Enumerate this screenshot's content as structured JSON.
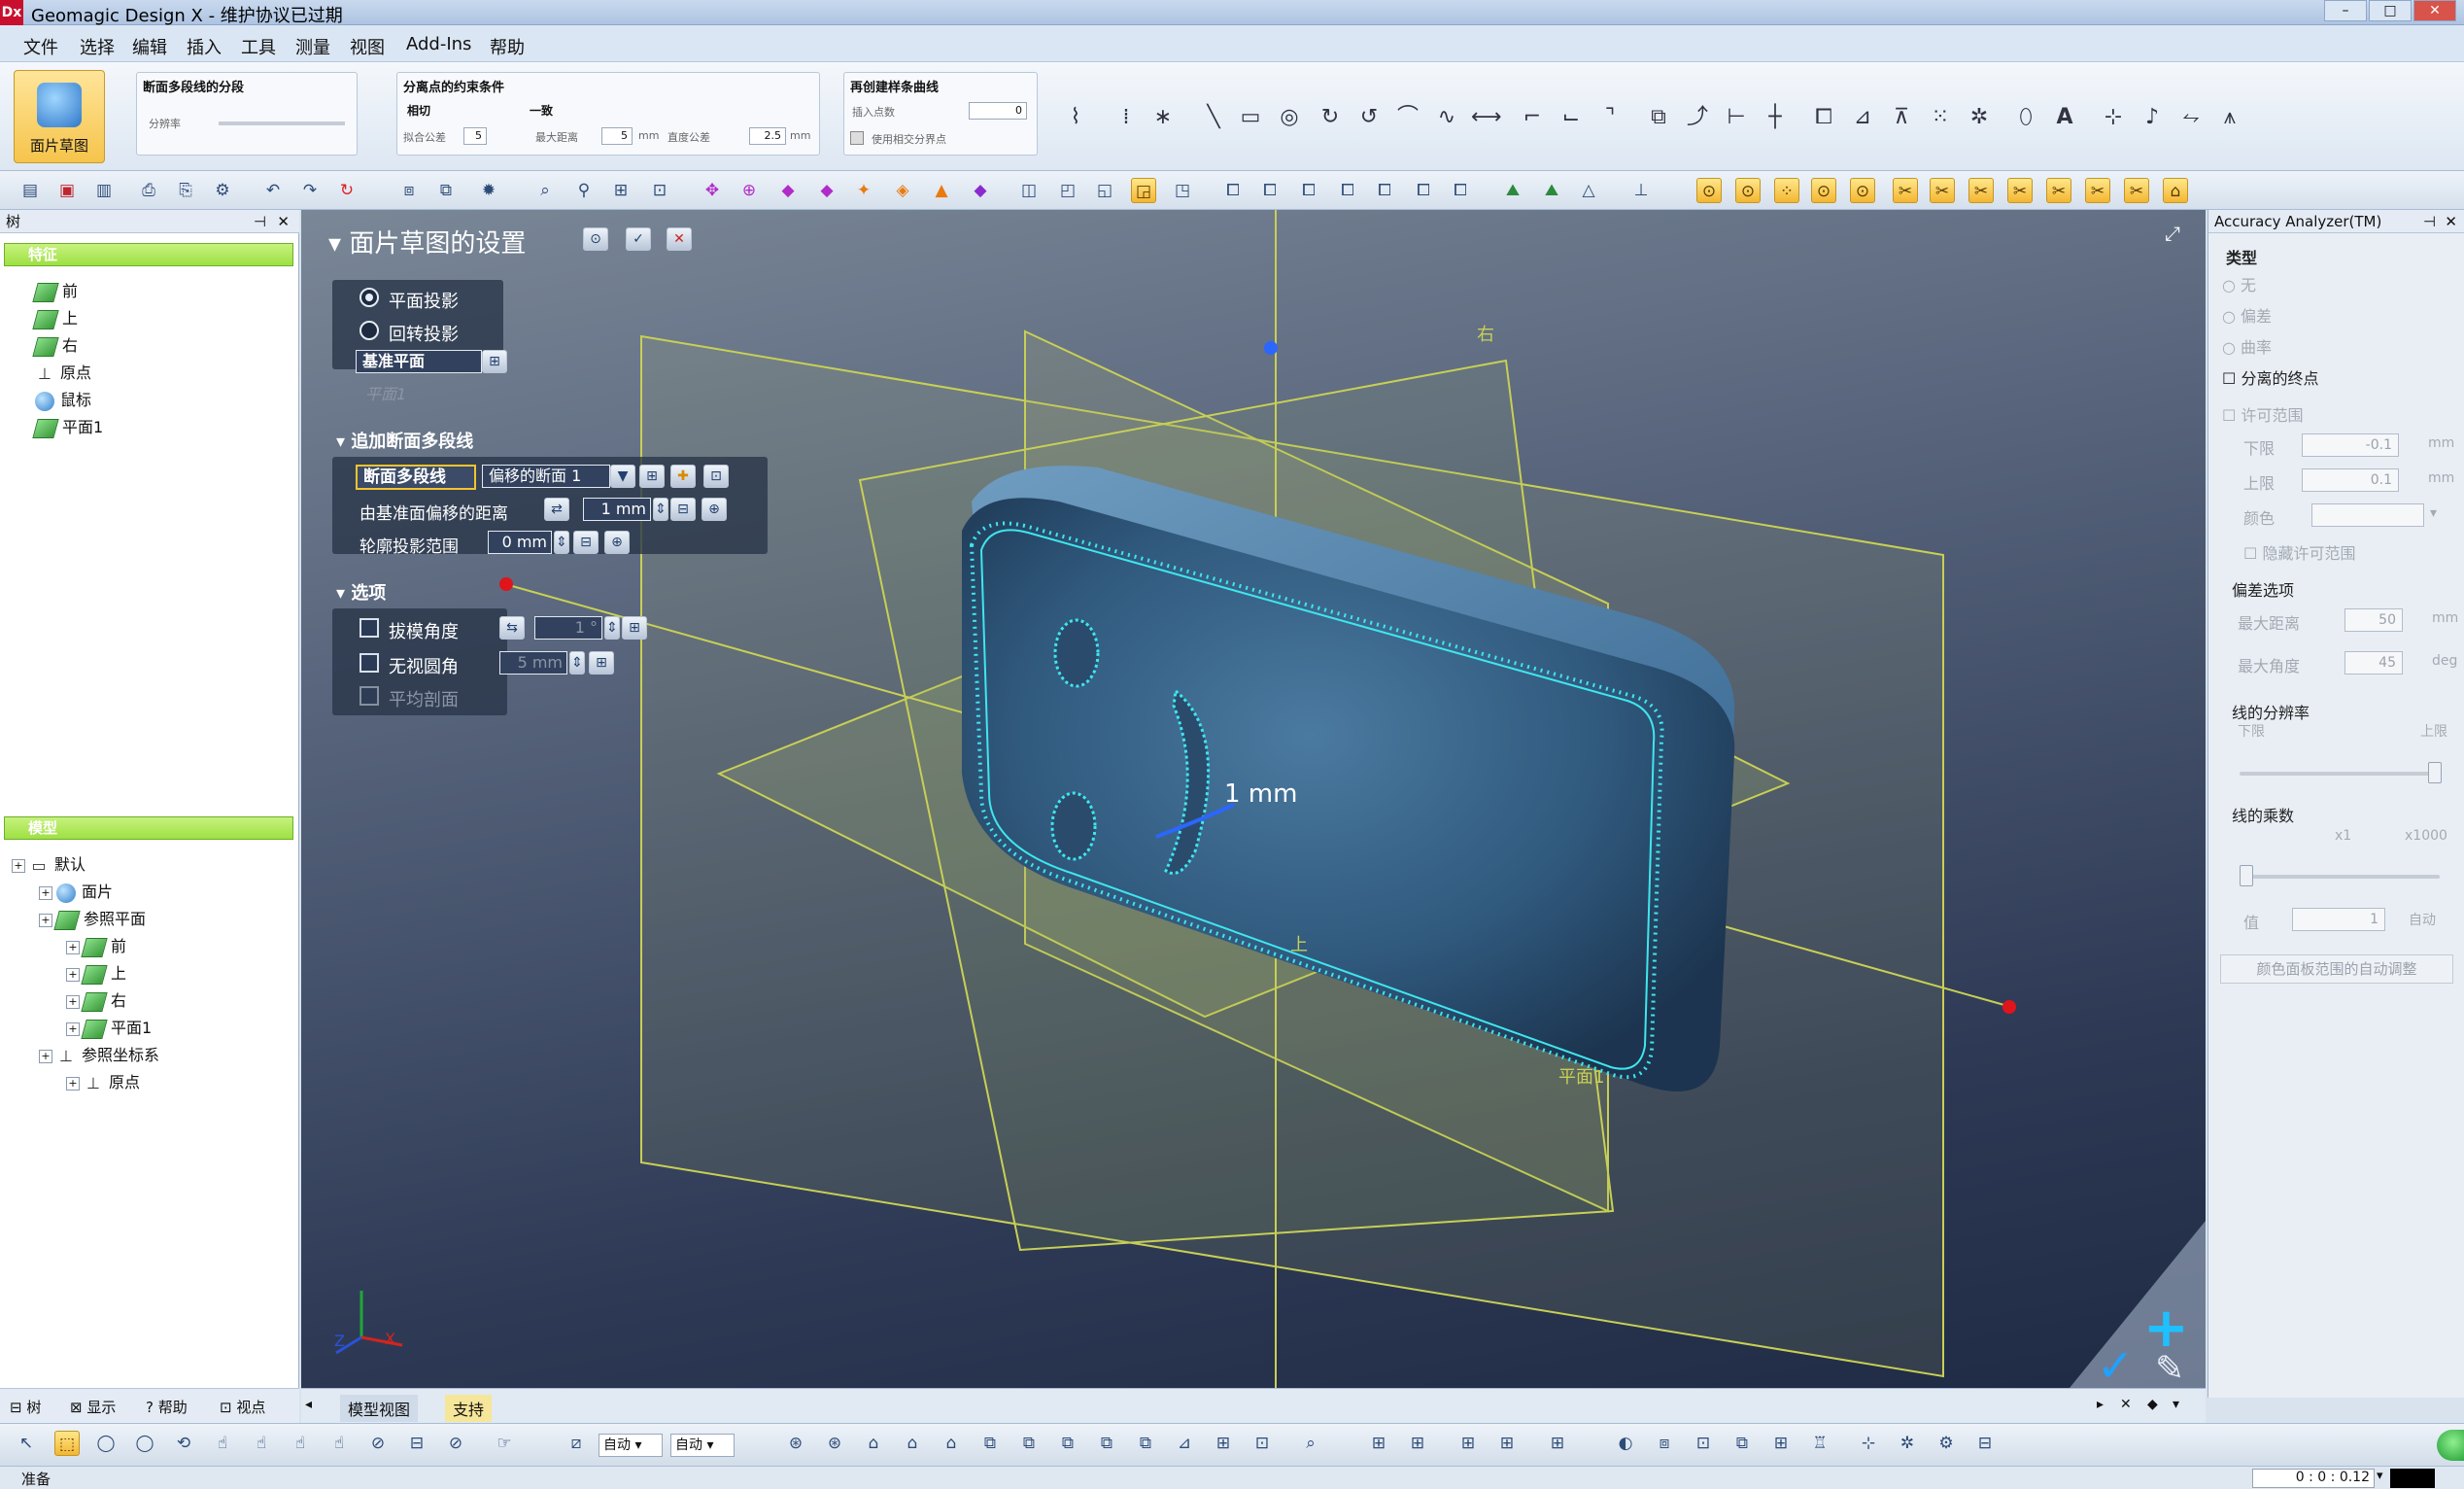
{
  "app": {
    "icon": "Dx",
    "title": "Geomagic Design X - 维护协议已过期"
  },
  "menu": [
    "文件",
    "选择",
    "编辑",
    "插入",
    "工具",
    "测量",
    "视图",
    "Add-Ins",
    "帮助"
  ],
  "ribbon": {
    "big_button": "面片草图",
    "group1": {
      "title": "断面多段线的分段",
      "label": "分辨率"
    },
    "group2": {
      "title": "分离点的约束条件",
      "sub1": "相切",
      "sub2": "一致",
      "f1_label": "拟合公差",
      "f1_value": "5",
      "f2_label": "最大距离",
      "f2_value": "5",
      "f2_unit": "mm",
      "f3_label": "直度公差",
      "f3_value": "2.5",
      "f3_unit": "mm"
    },
    "group3": {
      "title": "再创建样条曲线",
      "label": "插入点数",
      "value": "0",
      "check": "使用相交分界点"
    }
  },
  "left": {
    "header": "树",
    "feature_section": "特征",
    "features": [
      {
        "label": "前",
        "icon": "plane-icon"
      },
      {
        "label": "上",
        "icon": "plane-icon"
      },
      {
        "label": "右",
        "icon": "plane-icon"
      },
      {
        "label": "原点",
        "icon": "axis-icon"
      },
      {
        "label": "鼠标",
        "icon": "mesh-icon"
      },
      {
        "label": "平面1",
        "icon": "plane-icon"
      }
    ],
    "model_section": "模型",
    "model_items": [
      {
        "label": "默认",
        "icon": "folder-icon",
        "indent": 0
      },
      {
        "label": "面片",
        "icon": "mesh-icon",
        "indent": 1
      },
      {
        "label": "参照平面",
        "icon": "plane-icon",
        "indent": 1
      },
      {
        "label": "前",
        "icon": "plane-icon",
        "indent": 2
      },
      {
        "label": "上",
        "icon": "plane-icon",
        "indent": 2
      },
      {
        "label": "右",
        "icon": "plane-icon",
        "indent": 2
      },
      {
        "label": "平面1",
        "icon": "plane-icon",
        "indent": 2
      },
      {
        "label": "参照坐标系",
        "icon": "axis-icon",
        "indent": 1
      },
      {
        "label": "原点",
        "icon": "axis-icon",
        "indent": 2
      }
    ],
    "tabs": [
      "树",
      "显示",
      "帮助",
      "视点"
    ]
  },
  "settings": {
    "title": "面片草图的设置",
    "radio1": "平面投影",
    "radio2": "回转投影",
    "base_plane": "基准平面",
    "base_value": "平面1",
    "section2": "追加断面多段线",
    "section_polyline": "断面多段线",
    "offset_select": "偏移的断面 1",
    "offset_label": "由基准面偏移的距离",
    "offset_value": "1 mm",
    "contour_label": "轮廓投影范围",
    "contour_value": "0 mm",
    "section3": "选项",
    "opt1": "拔模角度",
    "opt1_value": "1 °",
    "opt2": "无视圆角",
    "opt2_value": "5 mm",
    "opt3": "平均剖面"
  },
  "viewport": {
    "dimension": "1 mm",
    "label_right": "右",
    "label_top": "上",
    "label_plane": "平面1",
    "axis_x": "X",
    "axis_z": "Z"
  },
  "right": {
    "title": "Accuracy Analyzer(TM)",
    "type_label": "类型",
    "types": [
      "无",
      "偏差",
      "曲率"
    ],
    "check_sep": "分离的终点",
    "tolerance_label": "许可范围",
    "lower_label": "下限",
    "lower_value": "-0.1",
    "upper_label": "上限",
    "upper_value": "0.1",
    "unit_mm": "mm",
    "color_label": "颜色",
    "hide_label": "隐藏许可范围",
    "dev_section": "偏差选项",
    "maxdist_label": "最大距离",
    "maxdist_value": "50",
    "maxangle_label": "最大角度",
    "maxangle_value": "45",
    "unit_deg": "deg",
    "res_section": "线的分辨率",
    "res_low": "下限",
    "res_high": "上限",
    "mult_section": "线的乘数",
    "mult_low": "x1",
    "mult_high": "x1000",
    "value_label": "值",
    "value_value": "1",
    "auto_label": "自动",
    "auto_btn": "颜色面板范围的自动调整"
  },
  "tabs": {
    "t1": "模型视图",
    "t2": "支持"
  },
  "bottom": {
    "combo1": "自动",
    "combo2": "自动"
  },
  "status": {
    "text": "准备",
    "time": "0 : 0 : 0.12"
  }
}
